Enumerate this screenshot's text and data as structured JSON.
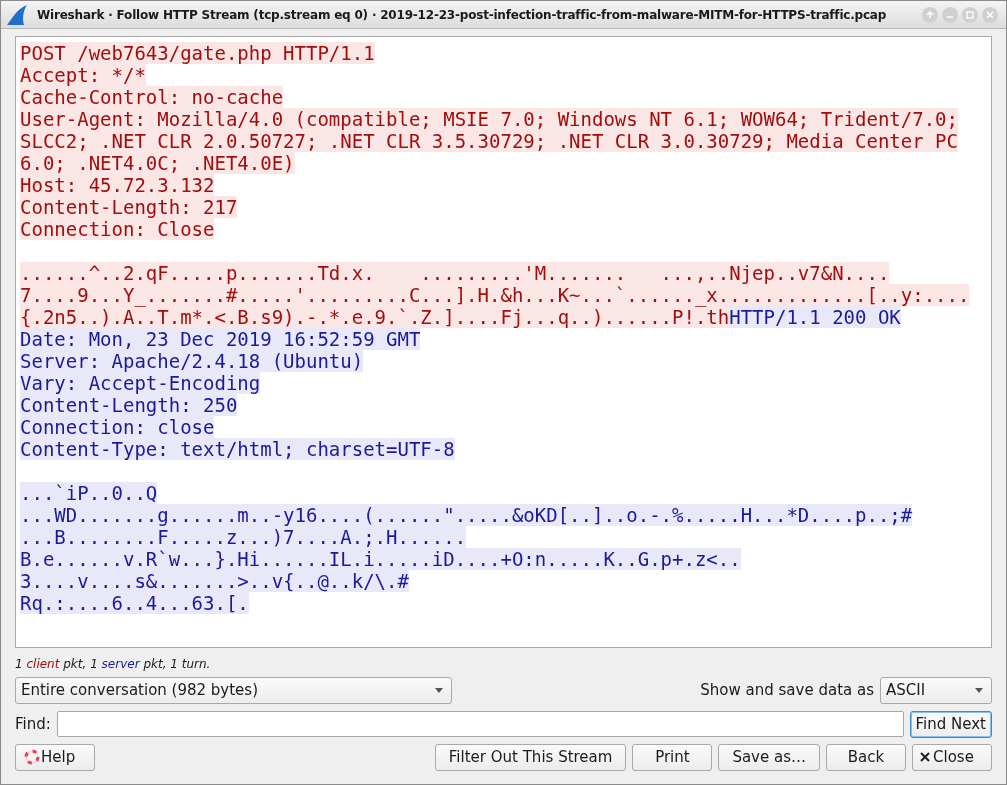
{
  "window": {
    "title": "Wireshark · Follow HTTP Stream (tcp.stream eq 0) · 2019-12-23-post-infection-traffic-from-malware-MITM-for-HTTPS-traffic.pcap"
  },
  "stream": [
    {
      "kind": "text",
      "segments": [
        {
          "kind": "client",
          "text": "POST /web7643/gate.php HTTP/1.1"
        }
      ]
    },
    {
      "kind": "text",
      "segments": [
        {
          "kind": "client",
          "text": "Accept: */*"
        }
      ]
    },
    {
      "kind": "text",
      "segments": [
        {
          "kind": "client",
          "text": "Cache-Control: no-cache"
        }
      ]
    },
    {
      "kind": "text",
      "segments": [
        {
          "kind": "client",
          "text": "User-Agent: Mozilla/4.0 (compatible; MSIE 7.0; Windows NT 6.1; WOW64; Trident/7.0;"
        }
      ]
    },
    {
      "kind": "text",
      "segments": [
        {
          "kind": "client",
          "text": "SLCC2; .NET CLR 2.0.50727; .NET CLR 3.5.30729; .NET CLR 3.0.30729; Media Center PC"
        }
      ]
    },
    {
      "kind": "text",
      "segments": [
        {
          "kind": "client",
          "text": "6.0; .NET4.0C; .NET4.0E)"
        }
      ]
    },
    {
      "kind": "text",
      "segments": [
        {
          "kind": "client",
          "text": "Host: 45.72.3.132"
        }
      ]
    },
    {
      "kind": "text",
      "segments": [
        {
          "kind": "client",
          "text": "Content-Length: 217"
        }
      ]
    },
    {
      "kind": "text",
      "segments": [
        {
          "kind": "client",
          "text": "Connection: Close"
        }
      ]
    },
    {
      "kind": "blank"
    },
    {
      "kind": "text",
      "segments": [
        {
          "kind": "client",
          "text": "......^..2.qF.....p.......Td.x.    .........'M.......   ...,..Njep..v7&N...."
        }
      ]
    },
    {
      "kind": "text",
      "segments": [
        {
          "kind": "client",
          "text": "7....9...Y_.......#.....'.........C...].H.&h...K~...`......_x.............[..y:...."
        }
      ]
    },
    {
      "kind": "text",
      "segments": [
        {
          "kind": "client",
          "text": "{.2n5..).A..T.m*.<.B.s9).-.*.e.9.`.Z.]....Fj...q..)......P!.th"
        },
        {
          "kind": "server",
          "text": "HTTP/1.1 200 OK"
        }
      ]
    },
    {
      "kind": "text",
      "segments": [
        {
          "kind": "server",
          "text": "Date: Mon, 23 Dec 2019 16:52:59 GMT"
        }
      ]
    },
    {
      "kind": "text",
      "segments": [
        {
          "kind": "server",
          "text": "Server: Apache/2.4.18 (Ubuntu)"
        }
      ]
    },
    {
      "kind": "text",
      "segments": [
        {
          "kind": "server",
          "text": "Vary: Accept-Encoding"
        }
      ]
    },
    {
      "kind": "text",
      "segments": [
        {
          "kind": "server",
          "text": "Content-Length: 250"
        }
      ]
    },
    {
      "kind": "text",
      "segments": [
        {
          "kind": "server",
          "text": "Connection: close"
        }
      ]
    },
    {
      "kind": "text",
      "segments": [
        {
          "kind": "server",
          "text": "Content-Type: text/html; charset=UTF-8"
        }
      ]
    },
    {
      "kind": "blank"
    },
    {
      "kind": "text",
      "segments": [
        {
          "kind": "server",
          "text": "...`iP..0..Q"
        }
      ]
    },
    {
      "kind": "text",
      "segments": [
        {
          "kind": "server",
          "text": "...WD.......g......m..-y16....(......\".....&oKD[..]..o.-.%.....H...*D....p..;#"
        }
      ]
    },
    {
      "kind": "text",
      "segments": [
        {
          "kind": "server",
          "text": "...B........F.....z...)7....A.;.H......"
        }
      ]
    },
    {
      "kind": "text",
      "segments": [
        {
          "kind": "server",
          "text": "B.e......v.R`w...}.Hi......IL.i.....iD....+O:n.....K..G.p+.z<.."
        }
      ]
    },
    {
      "kind": "text",
      "segments": [
        {
          "kind": "server",
          "text": "3....v....s&.......>..v{..@..k/\\.#"
        }
      ]
    },
    {
      "kind": "text",
      "segments": [
        {
          "kind": "server",
          "text": "Rq.:....6..4...63.[."
        }
      ]
    }
  ],
  "summary": [
    {
      "kind": "plain",
      "text": "1 "
    },
    {
      "kind": "client",
      "text": "client"
    },
    {
      "kind": "plain",
      "text": " pkt, 1 "
    },
    {
      "kind": "server",
      "text": "server"
    },
    {
      "kind": "plain",
      "text": " pkt, 1 turn."
    }
  ],
  "conversation_select": {
    "value": "Entire conversation (982 bytes)"
  },
  "format": {
    "label": "Show and save data as",
    "value": "ASCII"
  },
  "find": {
    "label": "Find:",
    "button": {
      "label": "Find Next",
      "focused": true
    }
  },
  "buttons": [
    {
      "kind": "help",
      "label": "Help"
    },
    {
      "kind": "spacer"
    },
    {
      "kind": "plain",
      "label": "Filter Out This Stream"
    },
    {
      "kind": "plain",
      "label": "Print"
    },
    {
      "kind": "plain",
      "label": "Save as…"
    },
    {
      "kind": "plain",
      "label": "Back"
    },
    {
      "kind": "close",
      "label": "Close"
    }
  ]
}
